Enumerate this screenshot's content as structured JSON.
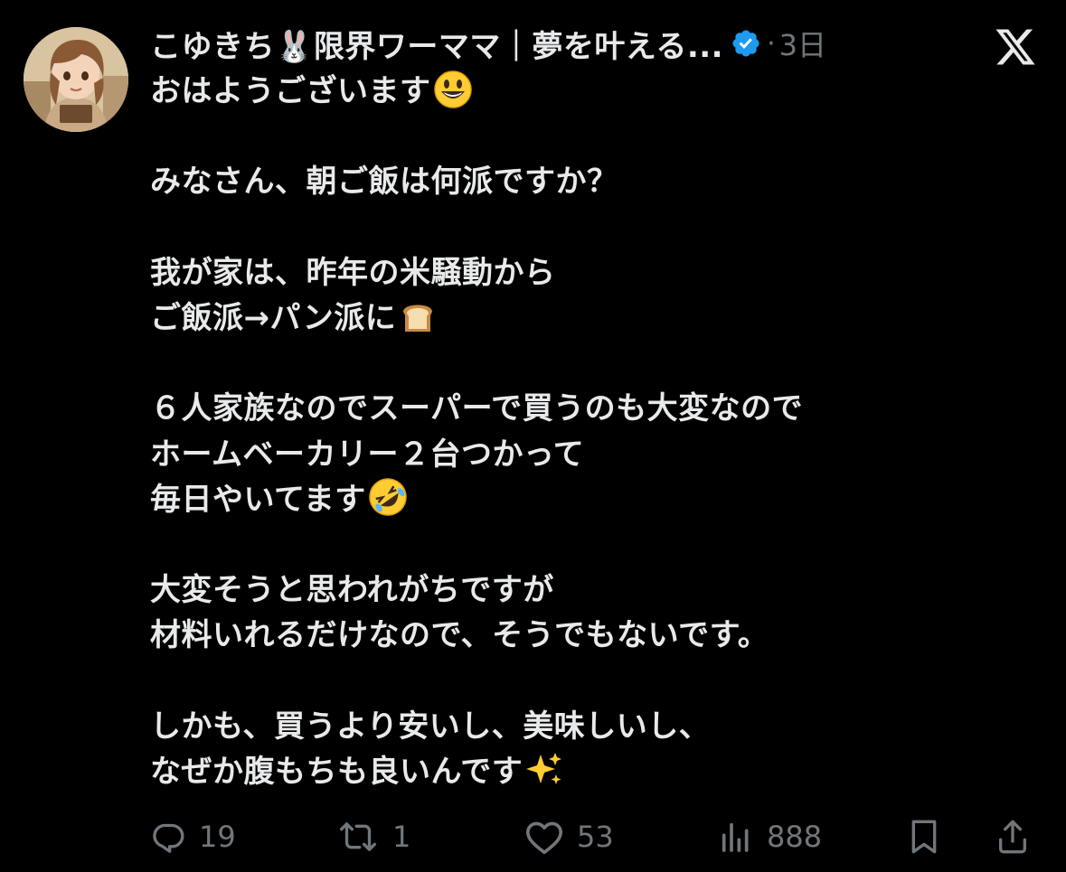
{
  "post": {
    "author": {
      "display_name": "こゆきち🐰限界ワーママ｜夢を叶える...",
      "verified_icon": "verified-badge-icon"
    },
    "separator": "·",
    "time": "3日",
    "brand_icon": "x-logo-icon",
    "text_lines": [
      "おはようございます",
      "",
      "みなさん、朝ご飯は何派ですか？",
      "",
      "我が家は、昨年の米騒動から",
      "ご飯派→パン派に",
      "",
      "６人家族なのでスーパーで買うのも大変なので",
      "ホームベーカリー２台つかって",
      "毎日やいてます",
      "",
      "大変そうと思われがちですが",
      "材料いれるだけなので、そうでもないです。",
      "",
      "しかも、買うより安いし、美味しいし、",
      "なぜか腹もちも良いんです"
    ],
    "emojis": [
      "grinning-face",
      "bread",
      "rolling-on-floor-laughing",
      "sparkles"
    ],
    "stats": {
      "replies": "19",
      "reposts": "1",
      "likes": "53",
      "views": "888"
    }
  },
  "colors": {
    "background": "#000000",
    "text": "#e7e9ea",
    "muted": "#71767b",
    "verified": "#1d9bf0"
  }
}
